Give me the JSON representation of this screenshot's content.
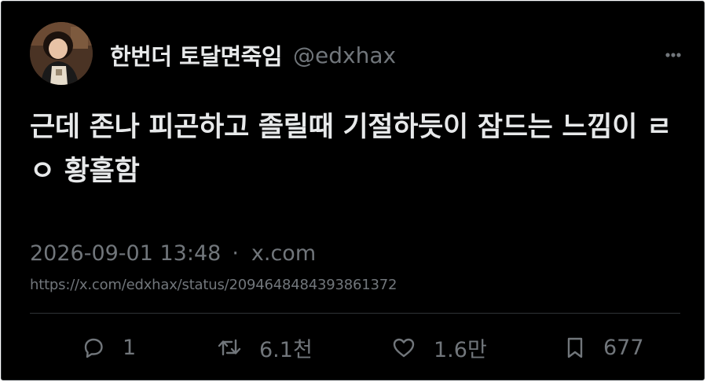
{
  "author": {
    "display_name": "한번더 토달면죽임",
    "handle": "@edxhax"
  },
  "tweet": {
    "text": "근데 존나 피곤하고 졸릴때 기절하듯이 잠드는 느낌이 ㄹㅇ 황홀함"
  },
  "meta": {
    "timestamp": "2026-09-01 13:48",
    "separator": "·",
    "source": "x.com"
  },
  "url": "https://x.com/edxhax/status/2094648484393861372",
  "actions": {
    "replies": "1",
    "reposts": "6.1천",
    "likes": "1.6만",
    "bookmarks": "677"
  },
  "icons": {
    "more": "more-horizontal-icon",
    "reply": "reply-icon",
    "repost": "repost-icon",
    "like": "heart-icon",
    "bookmark": "bookmark-icon"
  },
  "colors": {
    "background": "#000000",
    "text_primary": "#e7e9ea",
    "text_secondary": "#71767b",
    "divider": "#2f3336"
  }
}
